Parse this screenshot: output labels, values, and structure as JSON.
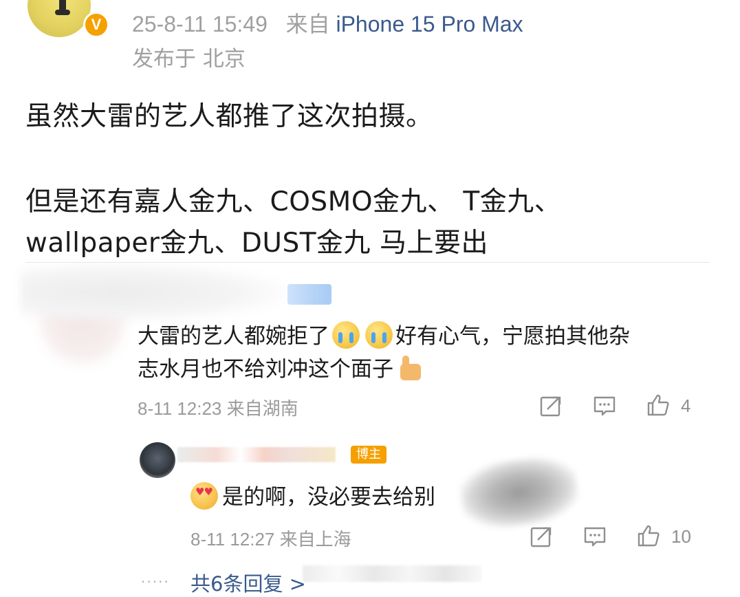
{
  "post": {
    "badge": "V",
    "time": "25-8-11 15:49",
    "from_label": "来自",
    "device": "iPhone 15 Pro Max",
    "location": "发布于 北京",
    "lines": [
      "虽然大雷的艺人都推了这次拍摄。",
      "但是还有嘉人金九、COSMO金九、 T金九、",
      "wallpaper金九、DUST金九 马上要出"
    ]
  },
  "comment": {
    "line1_a": "大雷的艺人都婉拒了",
    "line1_b": "好有心气，宁愿拍其他杂",
    "line2": "志水月也不给刘冲这个面子",
    "emojis": [
      "crying-face-icon",
      "crying-face-icon",
      "thumbs-up-icon"
    ],
    "time": "8-11 12:23",
    "source": "来自湖南",
    "like_count": "4"
  },
  "reply": {
    "badge": "博主",
    "text": "是的啊，没必要去给别",
    "emoji": "heart-eyes-icon",
    "time": "8-11 12:27",
    "source": "来自上海",
    "like_count": "10"
  },
  "more_replies": "共6条回复 >",
  "colors": {
    "link": "#3a5a8c",
    "meta": "#9a9a9a",
    "badge_orange": "#f5a000"
  }
}
